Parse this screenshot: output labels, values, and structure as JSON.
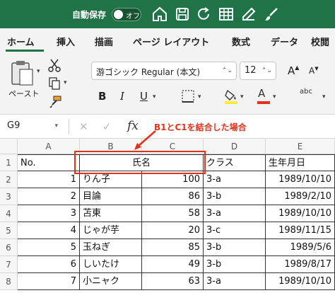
{
  "titlebar": {
    "autosave_label": "自動保存",
    "toggle_label": "オフ",
    "icons": [
      "home-icon",
      "save-icon",
      "refresh-icon",
      "table-icon",
      "edit-icon",
      "brush-icon"
    ]
  },
  "tabs": [
    "ホーム",
    "挿入",
    "描画",
    "ページ レイアウト",
    "数式",
    "データ",
    "校閲"
  ],
  "ribbon": {
    "paste_label": "ペースト",
    "font_name": "游ゴシック Regular (本文)",
    "font_size": "12",
    "grow_font": "A",
    "shrink_font": "A",
    "bold": "B",
    "italic": "I",
    "underline": "U",
    "font_color_glyph": "A",
    "abc_label": "abc",
    "fill_color": "#ffeb3b",
    "font_color": "#e2321b"
  },
  "formula_bar": {
    "name_box": "G9",
    "cancel_glyph": "✕",
    "enter_glyph": "✓",
    "fx_label": "fx"
  },
  "annotation": {
    "text": "B1とC1を結合した場合",
    "color": "#e2321b"
  },
  "sheet": {
    "columns": [
      "A",
      "B",
      "C",
      "D",
      "E"
    ],
    "rows": [
      "1",
      "2",
      "3",
      "4",
      "5",
      "6",
      "7",
      "8"
    ],
    "header": {
      "a": "No.",
      "bc_merged": "氏名",
      "d": "クラス",
      "e": "生年月日"
    },
    "data": [
      {
        "no": "1",
        "name": "りん子",
        "score": "100",
        "class": "3-a",
        "date": "1989/10/10"
      },
      {
        "no": "2",
        "name": "目論",
        "score": "86",
        "class": "3-b",
        "date": "1989/2/10"
      },
      {
        "no": "3",
        "name": "苫東",
        "score": "58",
        "class": "3-a",
        "date": "1989/10/10"
      },
      {
        "no": "4",
        "name": "じゃが芋",
        "score": "20",
        "class": "3-c",
        "date": "1989/11/15"
      },
      {
        "no": "5",
        "name": "玉ねぎ",
        "score": "85",
        "class": "3-b",
        "date": "1989/5/6"
      },
      {
        "no": "6",
        "name": "しいたけ",
        "score": "49",
        "class": "3-b",
        "date": "1989/8/17"
      },
      {
        "no": "7",
        "name": "小ニャク",
        "score": "63",
        "class": "3-a",
        "date": "1989/10/10"
      }
    ]
  }
}
